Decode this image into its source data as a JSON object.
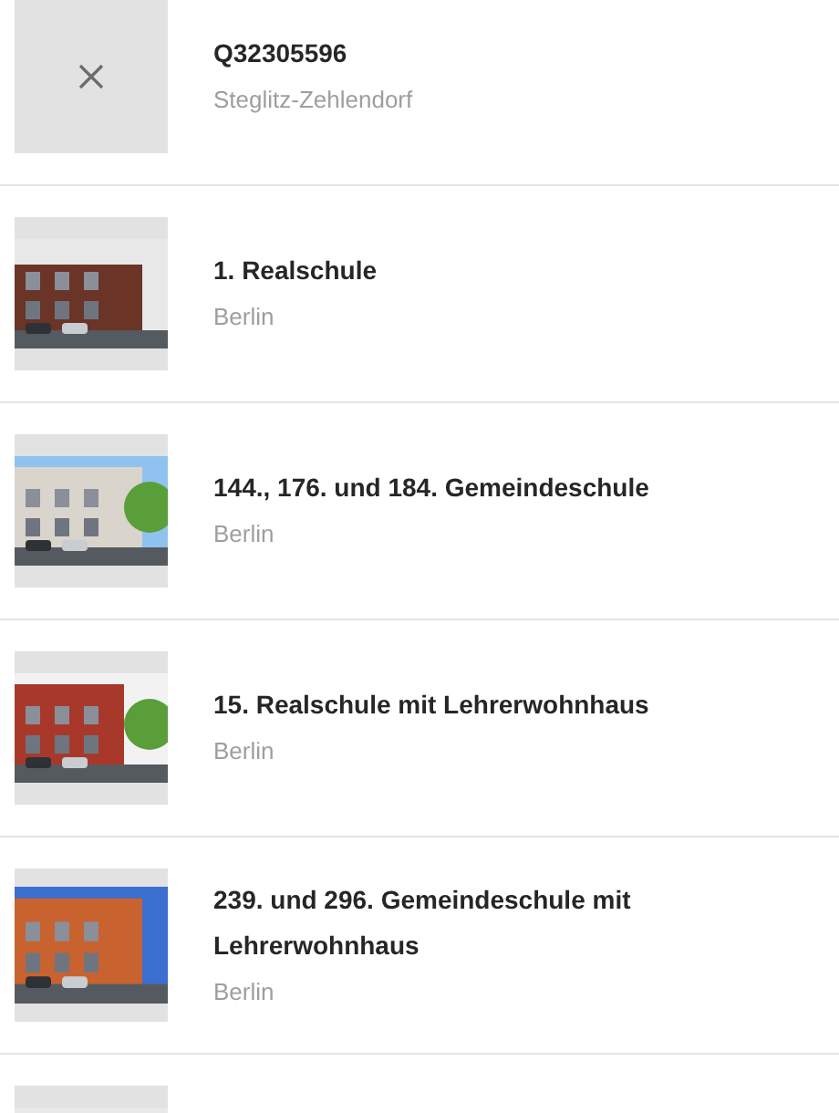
{
  "results": [
    {
      "kind": "placeholder",
      "title": "Q32305596",
      "subtitle": "Steglitz-Zehlendorf"
    },
    {
      "kind": "picture",
      "title": "1. Realschule",
      "subtitle": "Berlin"
    },
    {
      "kind": "picture",
      "title": "144., 176. und 184. Gemeindeschule",
      "subtitle": "Berlin"
    },
    {
      "kind": "picture",
      "title": "15. Realschule mit Lehrerwohnhaus",
      "subtitle": "Berlin"
    },
    {
      "kind": "picture",
      "title": "239. und 296. Gemeindeschule mit Lehrerwohnhaus",
      "subtitle": "Berlin"
    },
    {
      "kind": "picture"
    }
  ]
}
